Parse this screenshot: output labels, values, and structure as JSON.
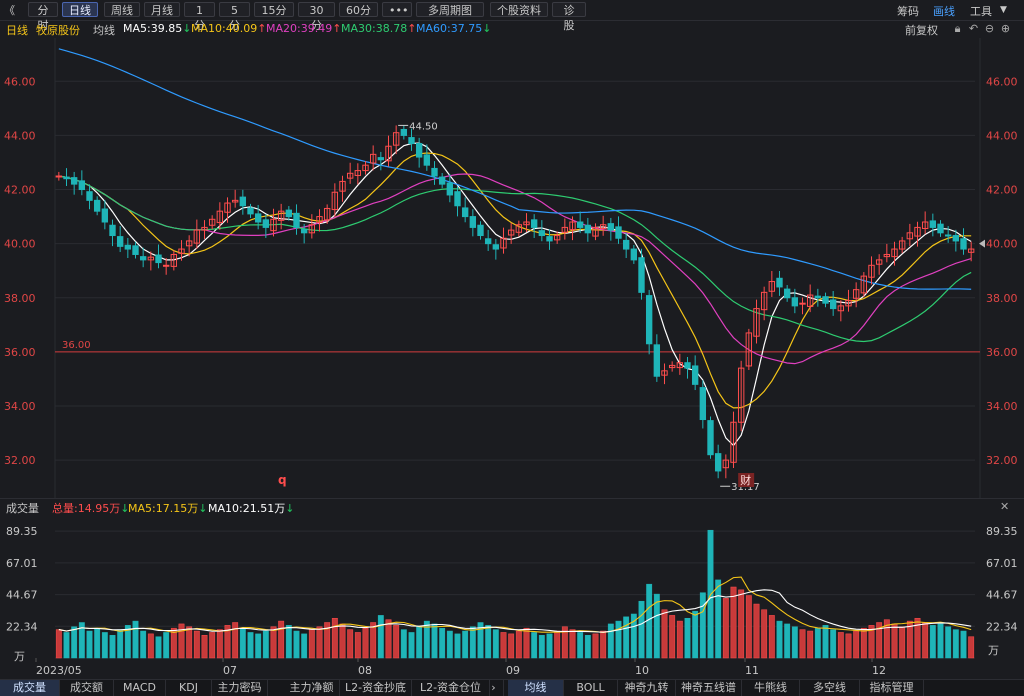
{
  "toolbar": {
    "back": "《",
    "buttons": [
      "分时",
      "日线",
      "周线",
      "月线",
      "1分",
      "5分",
      "15分",
      "30分",
      "60分",
      "•••",
      "多周期图",
      "个股资料",
      "诊股"
    ],
    "active": "日线",
    "right": [
      "筹码",
      "画线",
      "工具"
    ],
    "right_active": "画线"
  },
  "legend": {
    "period": "日线",
    "stock": "牧原股份",
    "ma_label": "均线",
    "ma5": "MA5:39.85",
    "ma10": "MA10:40.09",
    "ma20": "MA20:39.49",
    "ma30": "MA30:38.78",
    "ma60": "MA60:37.75",
    "adjust": "前复权",
    "colors": {
      "ma5": "#ffffff",
      "ma10": "#f5c518",
      "ma20": "#e040c0",
      "ma30": "#2ecc71",
      "ma60": "#2f9bff"
    }
  },
  "volume_header": {
    "title": "成交量",
    "total": "总量:14.95万",
    "ma5": "MA5:17.15万",
    "ma10": "MA10:21.51万"
  },
  "bottom_tabs": [
    "成交量",
    "成交额",
    "MACD",
    "KDJ",
    "主力密码",
    "主力净额",
    "L2-资金抄底",
    "L2-资金仓位",
    "均线",
    "BOLL",
    "神奇九转",
    "神奇五线谱",
    "牛熊线",
    "多空线",
    "指标管理"
  ],
  "markers": {
    "q": "q",
    "cai": "财"
  },
  "chart_data": [
    {
      "type": "candlestick",
      "yticks": [
        "46.00",
        "44.00",
        "42.00",
        "40.00",
        "38.00",
        "36.00",
        "34.00",
        "32.00"
      ],
      "ylim": [
        30.6,
        47.6
      ],
      "xticks": [
        "2023/05",
        "07",
        "08",
        "09",
        "10",
        "11",
        "12"
      ],
      "hline": {
        "value": 36.0,
        "label": "36.00"
      },
      "annotations": [
        {
          "label": "44.50",
          "type": "high"
        },
        {
          "label": "31.17",
          "type": "low"
        }
      ],
      "current_marker": 40.0,
      "grid": true,
      "close": [
        42.5,
        42.4,
        42.2,
        42.0,
        41.6,
        41.2,
        40.8,
        40.3,
        39.9,
        39.8,
        39.6,
        39.4,
        39.5,
        39.3,
        39.2,
        39.6,
        39.8,
        40.1,
        40.5,
        40.6,
        40.9,
        41.2,
        41.5,
        41.6,
        41.4,
        41.1,
        40.8,
        40.6,
        40.9,
        41.2,
        41.0,
        40.6,
        40.4,
        40.7,
        41.0,
        41.3,
        41.9,
        42.3,
        42.6,
        42.7,
        42.9,
        43.3,
        43.1,
        43.6,
        44.1,
        44.0,
        43.7,
        43.2,
        42.9,
        42.5,
        42.2,
        41.8,
        41.4,
        41.0,
        40.6,
        40.3,
        40.0,
        39.8,
        40.2,
        40.5,
        40.7,
        40.8,
        40.6,
        40.3,
        40.1,
        40.3,
        40.6,
        40.8,
        40.6,
        40.4,
        40.6,
        40.7,
        40.5,
        40.2,
        39.8,
        39.4,
        38.2,
        36.3,
        35.1,
        35.3,
        35.5,
        35.6,
        35.4,
        34.8,
        33.5,
        32.2,
        31.6,
        32.0,
        33.4,
        35.4,
        36.7,
        37.6,
        38.2,
        38.6,
        38.4,
        38.0,
        37.7,
        37.8,
        38.1,
        38.0,
        37.8,
        37.6,
        37.7,
        37.9,
        38.3,
        38.8,
        39.2,
        39.4,
        39.6,
        39.8,
        40.1,
        40.4,
        40.6,
        40.8,
        40.6,
        40.4,
        40.3,
        40.1,
        39.8,
        39.8
      ],
      "ma5_last": 39.85,
      "ma10_last": 40.09,
      "ma20_last": 39.49,
      "ma30_last": 38.78,
      "ma60_last": 37.75,
      "ma60_start": 47.2
    },
    {
      "type": "bar",
      "name": "volume",
      "yticks": [
        "89.35",
        "67.01",
        "44.67",
        "22.34"
      ],
      "ylim": [
        0,
        100
      ],
      "unit": "万",
      "values": [
        20,
        18,
        22,
        25,
        19,
        21,
        18,
        16,
        20,
        23,
        26,
        19,
        17,
        15,
        18,
        21,
        24,
        22,
        19,
        16,
        18,
        20,
        23,
        25,
        21,
        18,
        17,
        19,
        22,
        26,
        23,
        19,
        17,
        20,
        22,
        25,
        28,
        24,
        20,
        18,
        21,
        25,
        30,
        27,
        23,
        20,
        18,
        22,
        26,
        24,
        21,
        19,
        17,
        19,
        22,
        25,
        23,
        20,
        18,
        17,
        19,
        21,
        18,
        16,
        17,
        19,
        22,
        20,
        18,
        16,
        17,
        19,
        24,
        26,
        29,
        31,
        40,
        52,
        45,
        34,
        30,
        26,
        28,
        33,
        46,
        90,
        55,
        42,
        50,
        48,
        44,
        38,
        34,
        30,
        26,
        24,
        22,
        20,
        19,
        21,
        23,
        20,
        18,
        17,
        19,
        21,
        23,
        25,
        27,
        24,
        22,
        26,
        28,
        25,
        23,
        24,
        22,
        20,
        19,
        15
      ]
    }
  ]
}
